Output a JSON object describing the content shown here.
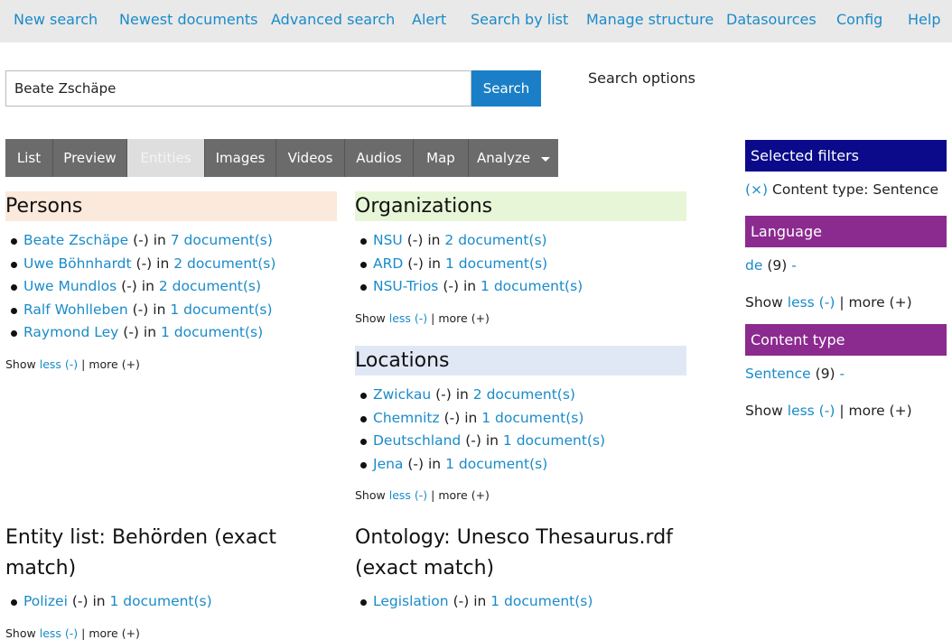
{
  "nav": {
    "items": [
      {
        "label": "New search"
      },
      {
        "label": "Newest documents"
      },
      {
        "label": "Advanced search"
      },
      {
        "label": "Alert"
      },
      {
        "label": "Search by list"
      },
      {
        "label": "Manage structure"
      },
      {
        "label": "Datasources"
      },
      {
        "label": "Config"
      },
      {
        "label": "Help"
      }
    ]
  },
  "search": {
    "value": "Beate Zschäpe",
    "button": "Search",
    "options": "Search options"
  },
  "tabs": [
    {
      "label": "List"
    },
    {
      "label": "Preview"
    },
    {
      "label": "Entities"
    },
    {
      "label": "Images"
    },
    {
      "label": "Videos"
    },
    {
      "label": "Audios"
    },
    {
      "label": "Map"
    },
    {
      "label": "Analyze"
    }
  ],
  "colors": {
    "link": "#1a8bc9",
    "persons_bg": "#fbe9dc",
    "organizations_bg": "#e8f6d8",
    "locations_bg": "#e0e8f6",
    "selected_filters_bg": "#0a0a8a",
    "facet_bg": "#8b2a8f"
  },
  "common": {
    "in": "in",
    "dash_link": "(-)",
    "show": "Show",
    "less": "less (-)",
    "sep": "|",
    "more": "more (+)"
  },
  "persons": {
    "title": "Persons",
    "items": [
      {
        "name": "Beate Zschäpe",
        "docs": "7 document(s)"
      },
      {
        "name": "Uwe Böhnhardt",
        "docs": "2 document(s)"
      },
      {
        "name": "Uwe Mundlos",
        "docs": "2 document(s)"
      },
      {
        "name": "Ralf Wohlleben",
        "docs": "1 document(s)"
      },
      {
        "name": "Raymond Ley",
        "docs": "1 document(s)"
      }
    ]
  },
  "organizations": {
    "title": "Organizations",
    "items": [
      {
        "name": "NSU",
        "docs": "2 document(s)"
      },
      {
        "name": "ARD",
        "docs": "1 document(s)"
      },
      {
        "name": "NSU-Trios",
        "docs": "1 document(s)"
      }
    ]
  },
  "locations": {
    "title": "Locations",
    "items": [
      {
        "name": "Zwickau",
        "docs": "2 document(s)"
      },
      {
        "name": "Chemnitz",
        "docs": "1 document(s)"
      },
      {
        "name": "Deutschland",
        "docs": "1 document(s)"
      },
      {
        "name": "Jena",
        "docs": "1 document(s)"
      }
    ]
  },
  "entity_list": {
    "title": "Entity list: Behörden (exact match)",
    "items": [
      {
        "name": "Polizei",
        "docs": "1 document(s)"
      }
    ]
  },
  "ontology": {
    "title": "Ontology: Unesco Thesaurus.rdf (exact match)",
    "items": [
      {
        "name": "Legislation",
        "docs": "1 document(s)"
      }
    ]
  },
  "sidebar": {
    "selected_title": "Selected filters",
    "remove": "(×)",
    "selected_filter": "Content type: Sentence",
    "language": {
      "title": "Language",
      "value": "de",
      "count": "(9)",
      "dash": "-"
    },
    "content_type": {
      "title": "Content type",
      "value": "Sentence",
      "count": "(9)",
      "dash": "-"
    }
  }
}
